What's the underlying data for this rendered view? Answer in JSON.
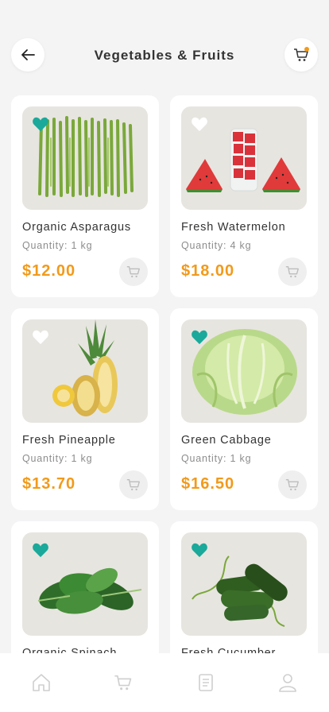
{
  "header": {
    "title": "Vegetables & Fruits",
    "back_icon": "arrow-left-icon",
    "cart_icon": "cart-icon",
    "cart_badge_color": "#f29a1a"
  },
  "colors": {
    "accent_teal": "#1aa99a",
    "price_orange": "#f29a1a",
    "card_bg": "#ffffff",
    "thumb_bg": "#e7e5e0"
  },
  "products": [
    {
      "name": "Organic Asparagus",
      "quantity": "Quantity: 1 kg",
      "price": "$12.00",
      "favorite": true,
      "image": "asparagus"
    },
    {
      "name": "Fresh Watermelon",
      "quantity": "Quantity: 4 kg",
      "price": "$18.00",
      "favorite": false,
      "image": "watermelon"
    },
    {
      "name": "Fresh Pineapple",
      "quantity": "Quantity: 1 kg",
      "price": "$13.70",
      "favorite": false,
      "image": "pineapple"
    },
    {
      "name": "Green Cabbage",
      "quantity": "Quantity: 1 kg",
      "price": "$16.50",
      "favorite": true,
      "image": "cabbage"
    },
    {
      "name": "Organic Spinach",
      "quantity": "",
      "price": "",
      "favorite": true,
      "image": "spinach"
    },
    {
      "name": "Fresh Cucumber",
      "quantity": "",
      "price": "",
      "favorite": true,
      "image": "cucumber"
    }
  ],
  "bottom_nav": [
    {
      "icon": "home-icon",
      "active": false
    },
    {
      "icon": "cart-icon",
      "active": false
    },
    {
      "icon": "orders-icon",
      "active": false
    },
    {
      "icon": "profile-icon",
      "active": false
    }
  ]
}
